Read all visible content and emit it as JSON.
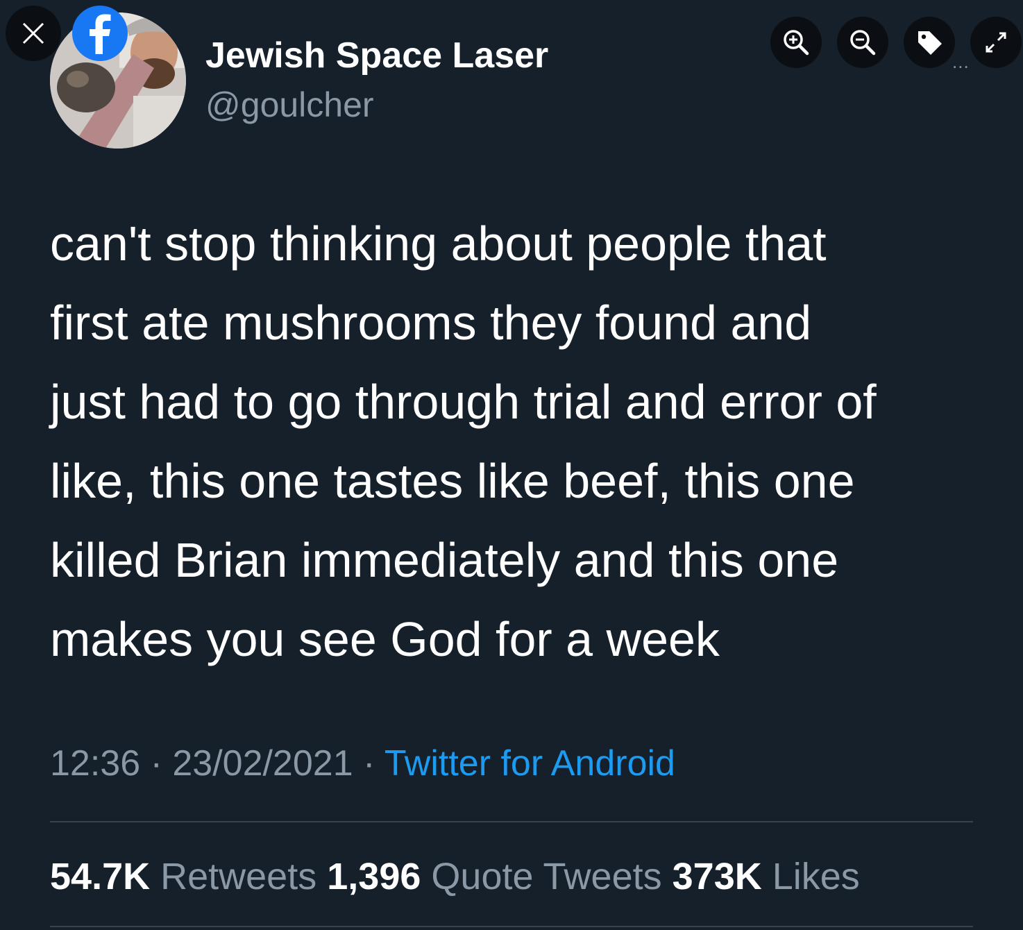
{
  "viewer": {
    "close_icon": "close-icon",
    "facebook_logo_icon": "facebook-logo-icon",
    "toolbar": [
      {
        "name": "zoom-in-button",
        "icon": "zoom-in-icon"
      },
      {
        "name": "zoom-out-button",
        "icon": "zoom-out-icon"
      },
      {
        "name": "tag-button",
        "icon": "tag-icon"
      },
      {
        "name": "fullscreen-button",
        "icon": "expand-icon"
      }
    ],
    "more_indicator": "..."
  },
  "tweet": {
    "display_name": "Jewish Space Laser",
    "handle": "@goulcher",
    "text_lines": [
      "can't stop thinking about people that",
      "first ate mushrooms they found and",
      "just had to go through trial and error of",
      "like, this one tastes like beef, this one",
      "killed Brian immediately and this one",
      "makes you see God for a week"
    ],
    "time": "12:36",
    "separator": " · ",
    "date": "23/02/2021",
    "source": "Twitter for Android",
    "stats": {
      "retweets_count": "54.7K",
      "retweets_label": "Retweets",
      "quote_tweets_count": "1,396",
      "quote_tweets_label": "Quote Tweets",
      "likes_count": "373K",
      "likes_label": "Likes"
    }
  },
  "colors": {
    "background": "#15202b",
    "text_primary": "#ffffff",
    "text_secondary": "#8b98a5",
    "link": "#1d9bf0",
    "facebook_blue": "#1877f2",
    "viewer_button_bg": "#0b0e12"
  }
}
